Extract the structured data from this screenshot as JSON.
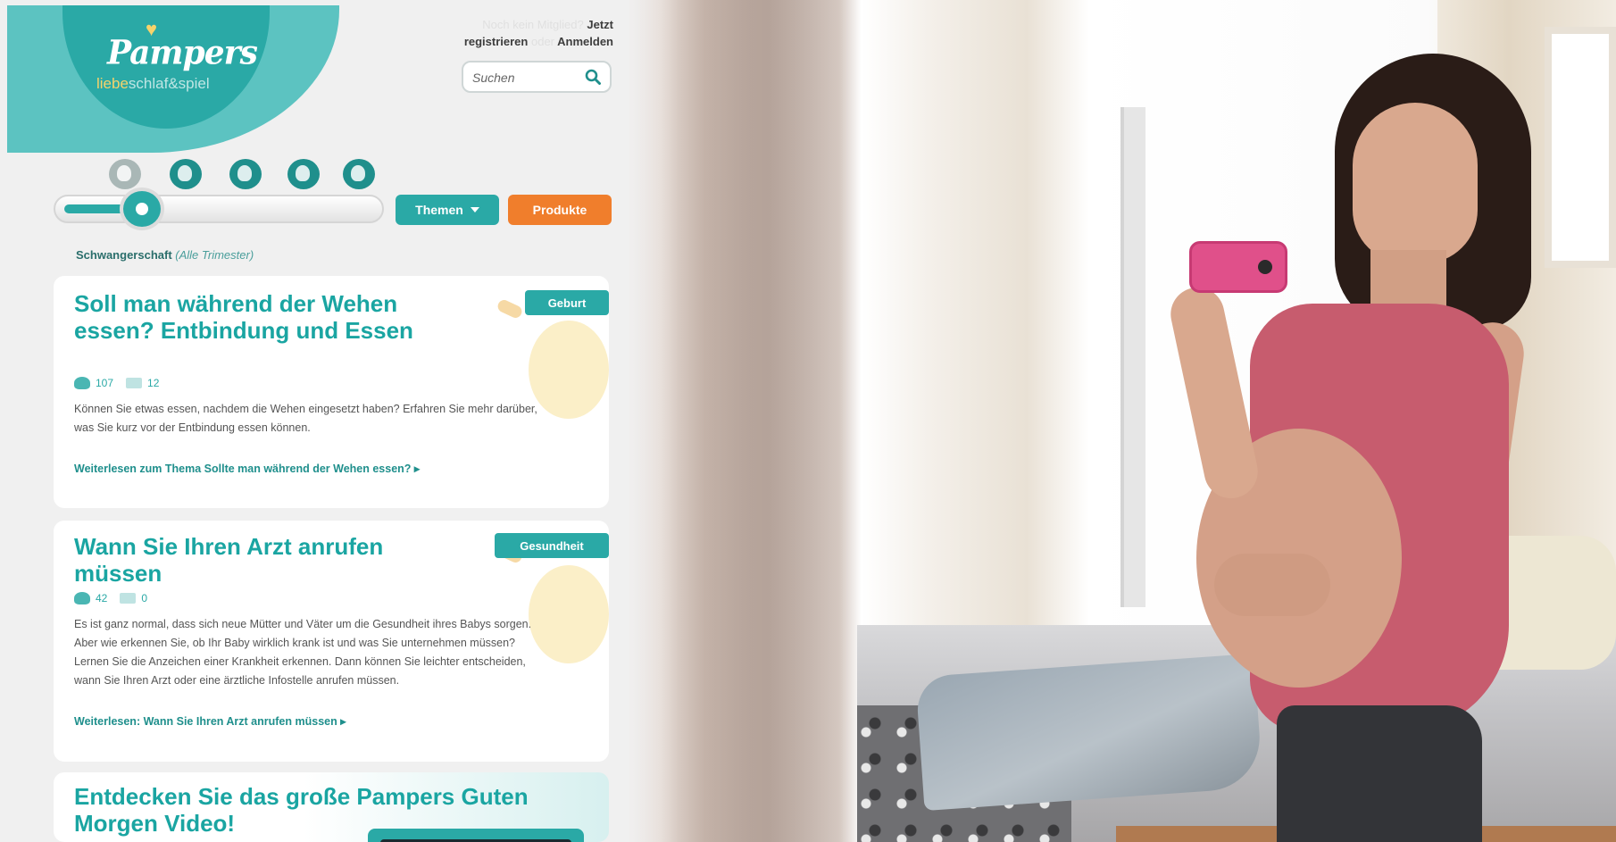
{
  "brand": {
    "logo": "Pampers",
    "tagline_part1": "liebe",
    "tagline_part2": "schlaf&spiel"
  },
  "header": {
    "faint_text": "Noch kein Mitglied?",
    "link_register_line1": "Jetzt",
    "link_register_line2": "registrieren",
    "link_separator": "oder",
    "link_login": "Anmelden"
  },
  "search": {
    "placeholder": "Suchen",
    "icon": "search-icon"
  },
  "stage_selector": {
    "icons": [
      "stage-pregnancy-icon",
      "stage-newborn-icon",
      "stage-baby-icon",
      "stage-toddler-icon",
      "stage-preschool-icon"
    ],
    "selected_index": 0
  },
  "buttons": {
    "themen": "Themen",
    "produkte": "Produkte"
  },
  "breadcrumb": {
    "main": "Schwangerschaft",
    "sub": "(Alle Trimester)"
  },
  "articles": [
    {
      "title": "Soll man während der Wehen essen? Entbindung und Essen",
      "tag": "Geburt",
      "likes": "107",
      "comments": "12",
      "body": "Können Sie etwas essen, nachdem die Wehen eingesetzt haben? Erfahren Sie mehr darüber, was Sie kurz vor der Entbindung essen können.",
      "read_more": "Weiterlesen zum Thema Sollte man während der Wehen essen? ▸"
    },
    {
      "title": "Wann Sie Ihren Arzt anrufen müssen",
      "tag": "Gesundheit",
      "likes": "42",
      "comments": "0",
      "body": "Es ist ganz normal, dass sich neue Mütter und Väter um die Gesundheit ihres Babys sorgen. Aber wie erkennen Sie, ob Ihr Baby wirklich krank ist und was Sie unternehmen müssen? Lernen Sie die Anzeichen einer Krankheit erkennen. Dann können Sie leichter entscheiden, wann Sie Ihren Arzt oder eine ärztliche Infostelle anrufen müssen.",
      "read_more": "Weiterlesen: Wann Sie Ihren Arzt anrufen müssen ▸"
    }
  ],
  "promo": {
    "title": "Entdecken Sie das große Pampers Guten Morgen Video!"
  },
  "colors": {
    "teal": "#2aa9a6",
    "teal_light": "#5cc3c1",
    "orange": "#f07e2c",
    "accent_yellow": "#f6d36b"
  }
}
